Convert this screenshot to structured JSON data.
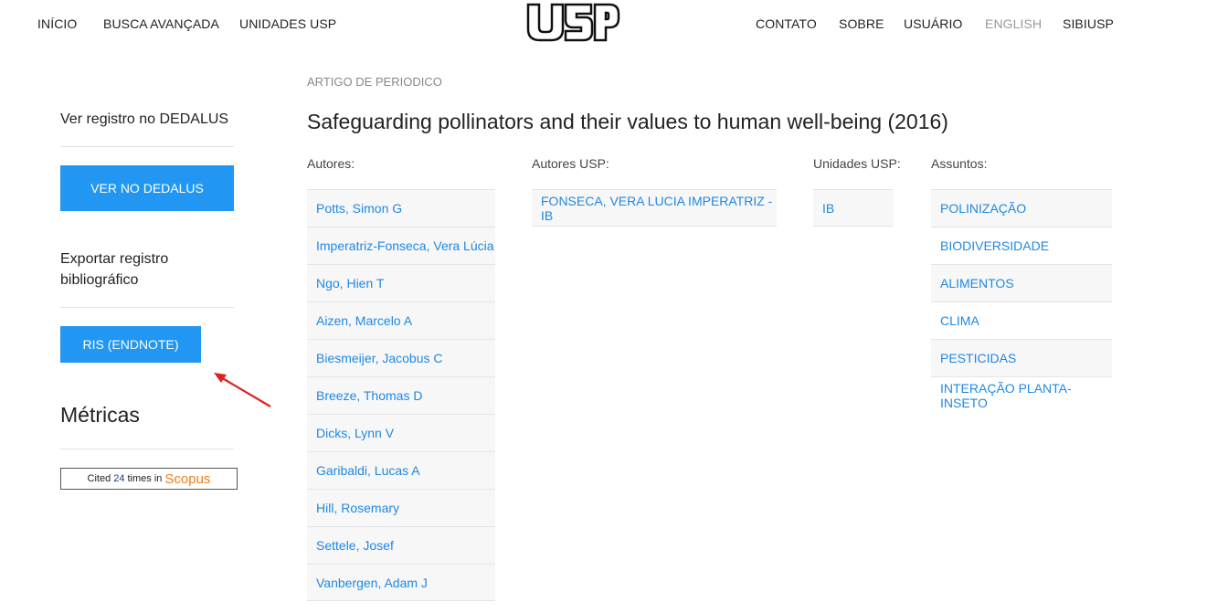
{
  "header": {
    "nav_left": [
      "INÍCIO",
      "BUSCA AVANÇADA",
      "UNIDADES USP"
    ],
    "logo": "USP",
    "nav_right": [
      "CONTATO",
      "SOBRE",
      "USUÁRIO",
      "ENGLISH",
      "SIBIUSP"
    ]
  },
  "sidebar": {
    "dedalus_heading": "Ver registro no DEDALUS",
    "dedalus_button": "VER NO DEDALUS",
    "export_heading_line1": "Exportar registro",
    "export_heading_line2": "bibliográfico",
    "ris_button": "RIS (ENDNOTE)",
    "metrics_heading": "Métricas",
    "scopus_badge": {
      "prefix": "Cited",
      "count": "24",
      "middle": "times in",
      "brand": "Scopus"
    }
  },
  "record": {
    "type": "ARTIGO DE PERIODICO",
    "title": "Safeguarding pollinators and their values to human well-being (2016)"
  },
  "columns": {
    "authors": {
      "label": "Autores:",
      "items": [
        "Potts, Simon G",
        "Imperatriz-Fonseca, Vera Lúcia",
        "Ngo, Hien T",
        "Aizen, Marcelo A",
        "Biesmeijer, Jacobus C",
        "Breeze, Thomas D",
        "Dicks, Lynn V",
        "Garibaldi, Lucas A",
        "Hill, Rosemary",
        "Settele, Josef",
        "Vanbergen, Adam J"
      ]
    },
    "usp_authors": {
      "label": "Autores USP:",
      "items": [
        "FONSECA, VERA LUCIA IMPERATRIZ - IB"
      ]
    },
    "usp_units": {
      "label": "Unidades USP:",
      "items": [
        "IB"
      ]
    },
    "subjects": {
      "label": "Assuntos:",
      "items": [
        "POLINIZAÇÃO",
        "BIODIVERSIDADE",
        "ALIMENTOS",
        "CLIMA",
        "PESTICIDAS",
        "INTERAÇÃO PLANTA-INSETO"
      ]
    }
  },
  "colors": {
    "accent": "#2196f3",
    "link": "#1e88e5",
    "annotation_arrow": "#e02020",
    "scopus": "#f07c1a"
  }
}
